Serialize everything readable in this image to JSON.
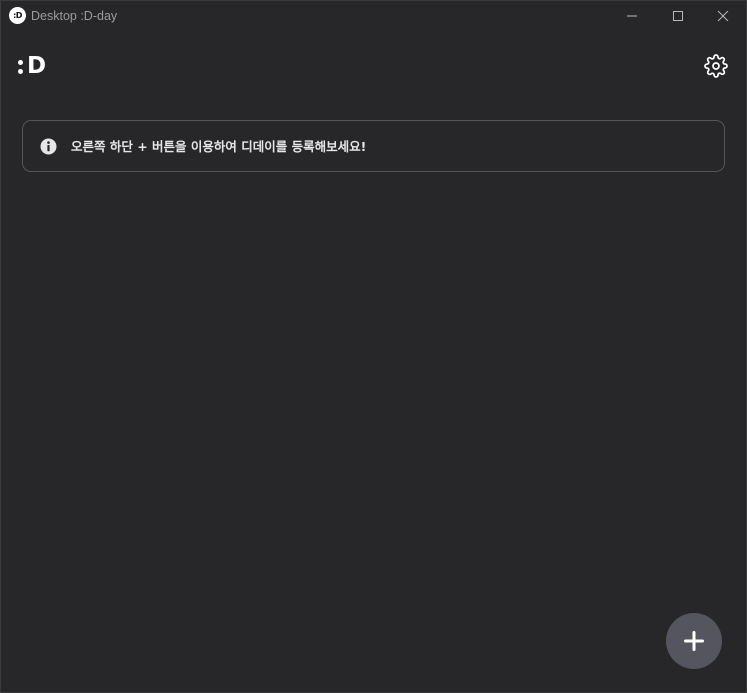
{
  "window": {
    "app_icon_text": ":D",
    "title": "Desktop :D-day"
  },
  "header": {
    "logo_text": "D",
    "settings_icon": "gear-icon"
  },
  "info": {
    "icon": "info-circle-icon",
    "message": "오른쪽 하단 + 버튼을 이용하여 디데이를 등록해보세요!"
  },
  "fab": {
    "icon": "plus-icon"
  },
  "colors": {
    "background": "#27272a",
    "text": "#ffffff",
    "border": "#55555a",
    "fab": "#55555f"
  }
}
